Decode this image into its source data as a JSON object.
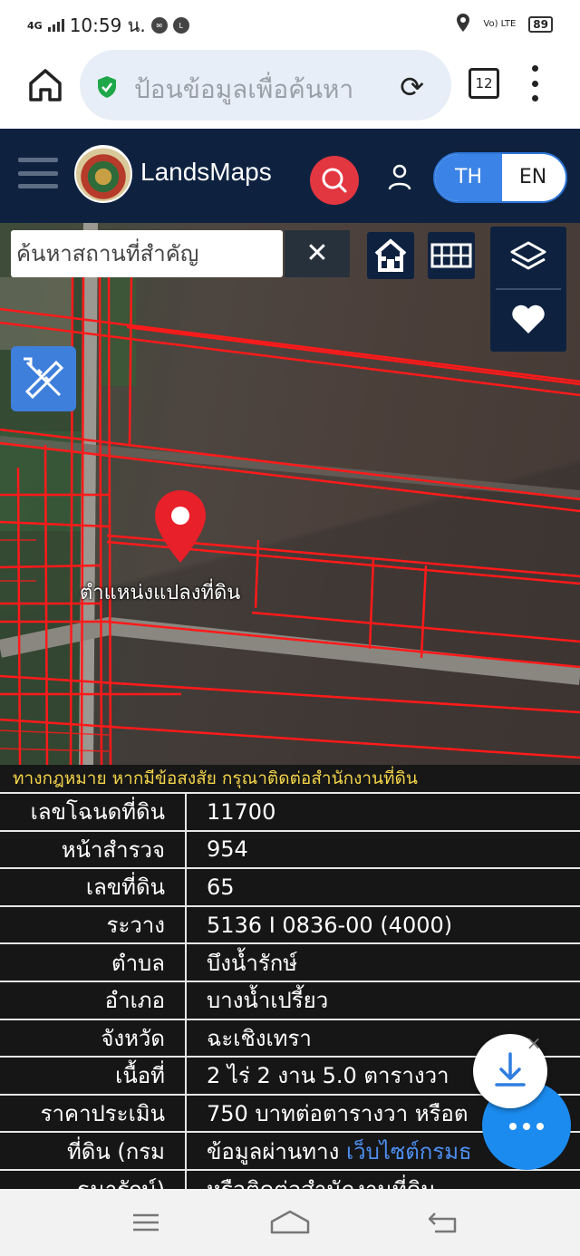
{
  "status_bar": {
    "network": "4G",
    "time": "10:59 น.",
    "volte": "Vo) LTE",
    "battery": "89"
  },
  "browser": {
    "url_placeholder": "ป้อนข้อมูลเพื่อค้นหา",
    "tab_count": "12"
  },
  "app": {
    "brand": "LandsMaps",
    "lang_th": "TH",
    "lang_en": "EN"
  },
  "map": {
    "search_placeholder": "ค้นหาสถานที่สำคัญ",
    "clear_symbol": "✕",
    "pin_label": "ตำแหน่งแปลงที่ดิน"
  },
  "parcel_info": {
    "notice": "ทางกฎหมาย หากมีข้อสงสัย กรุณาติดต่อสำนักงานที่ดิน",
    "rows": [
      {
        "label": "เลขโฉนดที่ดิน",
        "value": "11700"
      },
      {
        "label": "หน้าสำรวจ",
        "value": "954"
      },
      {
        "label": "เลขที่ดิน",
        "value": "65"
      },
      {
        "label": "ระวาง",
        "value": "5136 I 0836-00 (4000)"
      },
      {
        "label": "ตำบล",
        "value": "บึงน้ำรักษ์"
      },
      {
        "label": "อำเภอ",
        "value": "บางน้ำเปรี้ยว"
      },
      {
        "label": "จังหวัด",
        "value": "ฉะเชิงเทรา"
      },
      {
        "label": "เนื้อที่",
        "value": "2 ไร่ 2 งาน 5.0 ตารางวา"
      },
      {
        "label": "ราคาประเมิน",
        "value": "750 บาทต่อตารางวา หรือต"
      },
      {
        "label": "ที่ดิน (กรม",
        "value": "ข้อมูลผ่านทาง ",
        "link": "เว็บไซต์กรมธ"
      },
      {
        "label": "ธนารักษ์)",
        "value": "หรือติดต่อสำนักงานที่ดิน"
      }
    ]
  },
  "colors": {
    "header_bg": "#0e2240",
    "accent_blue": "#3b83e6",
    "search_red": "#e23640",
    "parcel_line": "#ff1a1a",
    "notice_text": "#f3d44a"
  }
}
